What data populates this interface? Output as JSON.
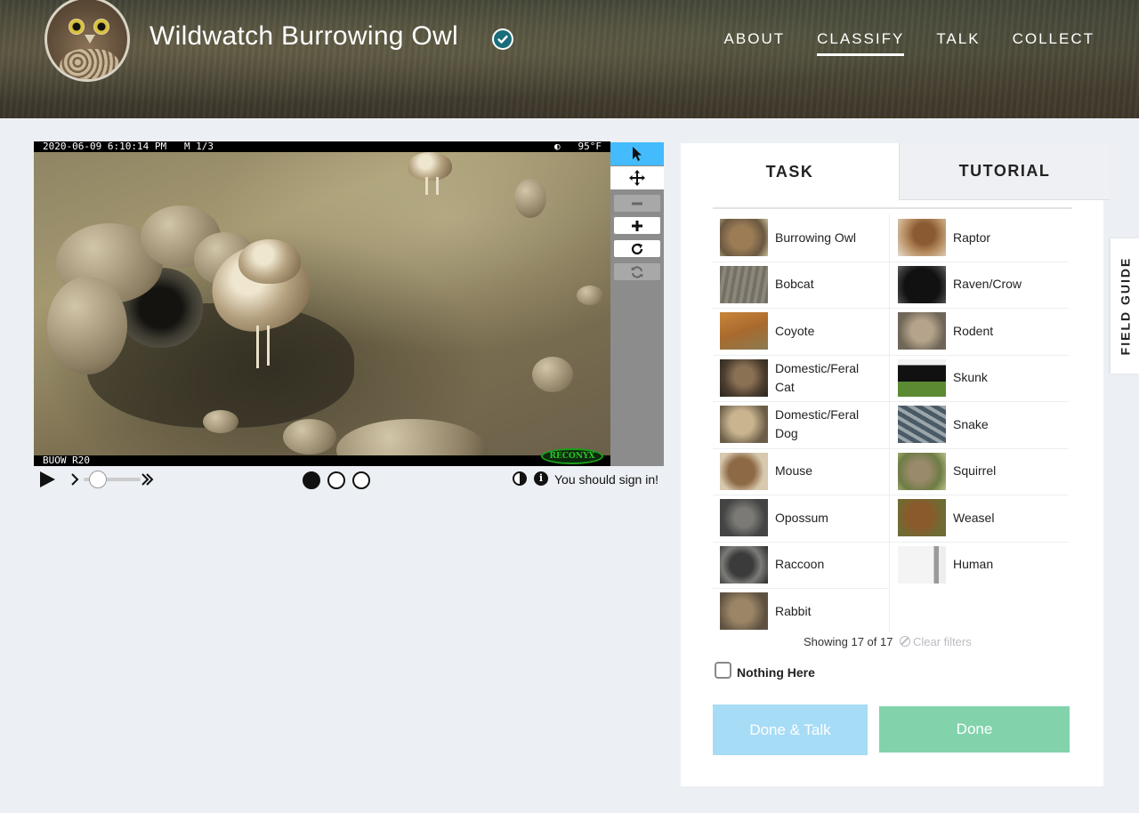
{
  "header": {
    "title": "Wildwatch Burrowing Owl",
    "nav": [
      {
        "label": "ABOUT",
        "active": false
      },
      {
        "label": "CLASSIFY",
        "active": true
      },
      {
        "label": "TALK",
        "active": false
      },
      {
        "label": "COLLECT",
        "active": false
      }
    ]
  },
  "subject": {
    "stamp_left": "2020-06-09 6:10:14 PM   M 1/3",
    "stamp_right": "◐   95°F",
    "camera_id": "BUOW R20",
    "watermark": "RECONYX"
  },
  "viewer_controls": {
    "frames": 3,
    "current_frame": 1,
    "signin_note": "You should sign in!"
  },
  "tabs": {
    "task": "TASK",
    "tutorial": "TUTORIAL"
  },
  "choices": [
    {
      "label": "Burrowing Owl",
      "thumb": "th-owl"
    },
    {
      "label": "Raptor",
      "thumb": "th-raptor"
    },
    {
      "label": "Bobcat",
      "thumb": "th-bobcat"
    },
    {
      "label": "Raven/Crow",
      "thumb": "th-raven"
    },
    {
      "label": "Coyote",
      "thumb": "th-coyote"
    },
    {
      "label": "Rodent",
      "thumb": "th-rodent"
    },
    {
      "label": "Domestic/Feral Cat",
      "thumb": "th-cat"
    },
    {
      "label": "Skunk",
      "thumb": "th-skunk"
    },
    {
      "label": "Domestic/Feral Dog",
      "thumb": "th-dog"
    },
    {
      "label": "Snake",
      "thumb": "th-snake"
    },
    {
      "label": "Mouse",
      "thumb": "th-mouse"
    },
    {
      "label": "Squirrel",
      "thumb": "th-squirrel"
    },
    {
      "label": "Opossum",
      "thumb": "th-opossum"
    },
    {
      "label": "Weasel",
      "thumb": "th-weasel"
    },
    {
      "label": "Raccoon",
      "thumb": "th-raccoon"
    },
    {
      "label": "Human",
      "thumb": "th-human"
    },
    {
      "label": "Rabbit",
      "thumb": "th-rabbit"
    }
  ],
  "filter": {
    "showing": "Showing 17 of 17",
    "clear": "Clear filters"
  },
  "nothing_here": "Nothing Here",
  "buttons": {
    "done_talk": "Done & Talk",
    "done": "Done"
  },
  "field_guide": "FIELD GUIDE",
  "colors": {
    "active_tool": "#43bbfd",
    "done_talk_bg": "#a6dcf6",
    "done_bg": "#82d3ac",
    "page_bg": "#eceff3"
  }
}
